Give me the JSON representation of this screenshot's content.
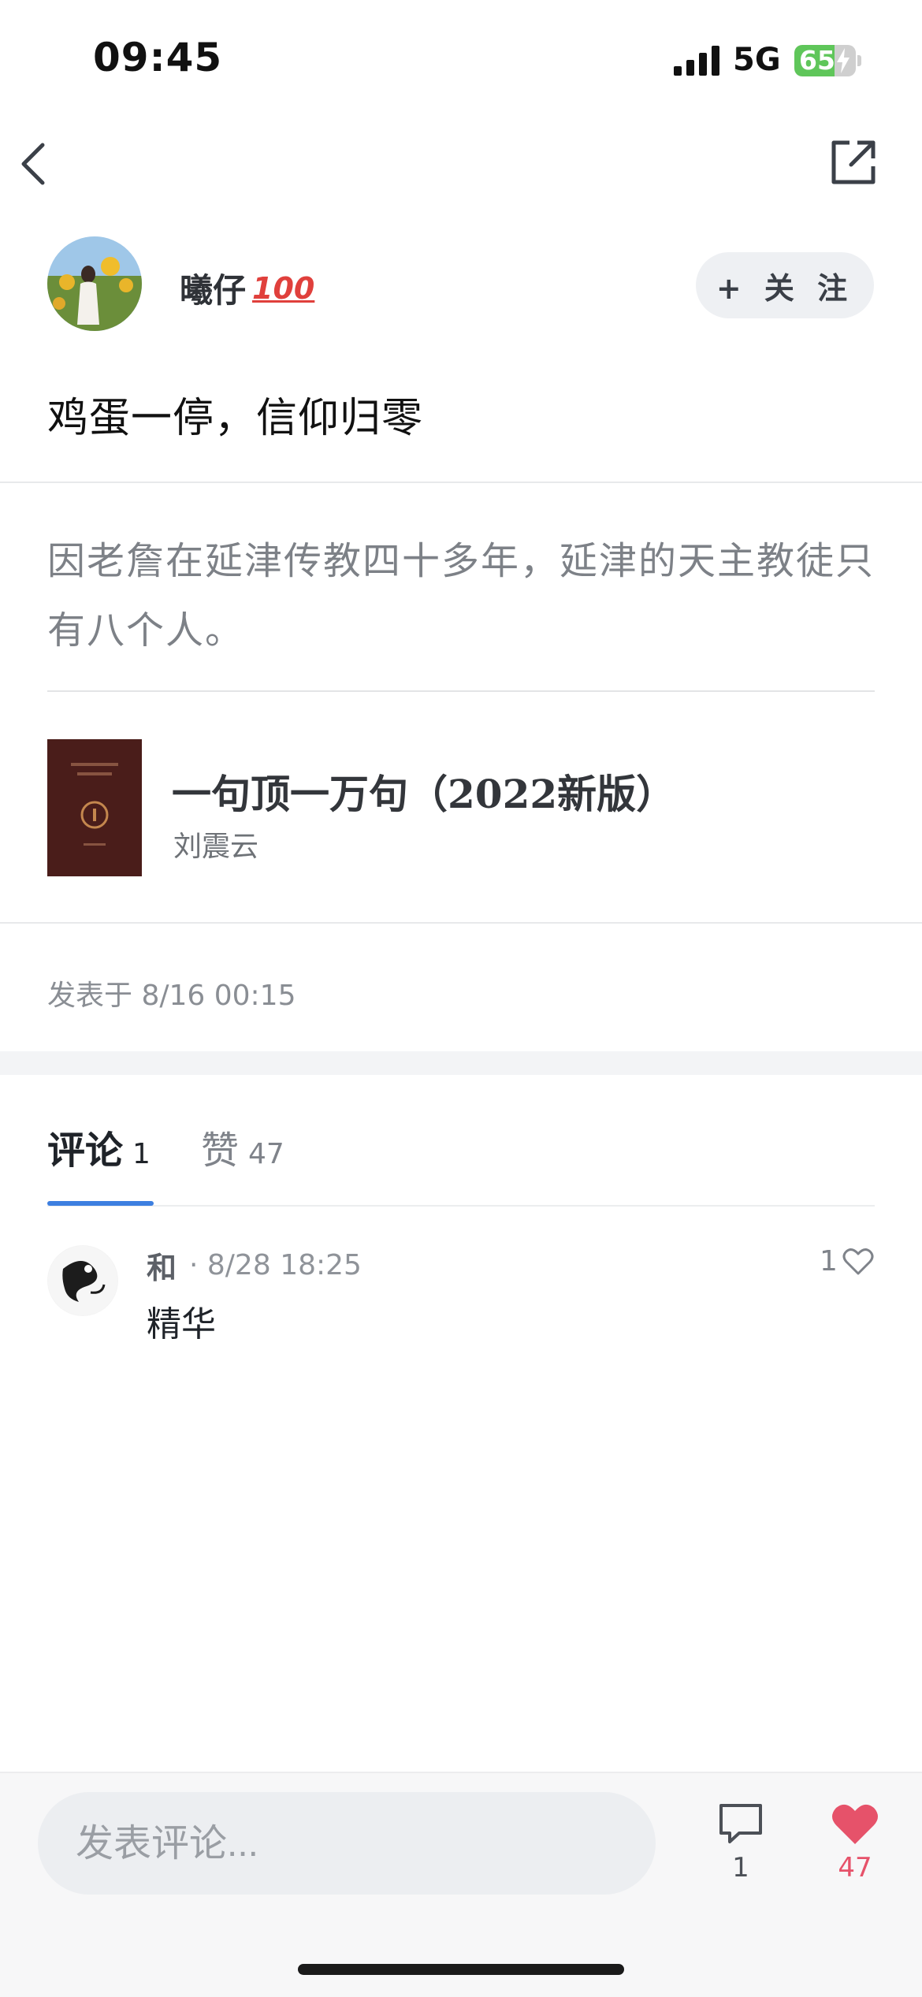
{
  "status_bar": {
    "time": "09:45",
    "network": "5G",
    "battery": "65",
    "battery_level": 0.65
  },
  "nav": {
    "back_icon": "chevron-left-icon",
    "share_icon": "share-icon"
  },
  "author": {
    "name": "曦仔",
    "badge": "100",
    "follow_label": "+ 关 注"
  },
  "post": {
    "title": "鸡蛋一停，信仰归零",
    "quote": "因老詹在延津传教四十多年，延津的天主教徒只有八个人。",
    "book": {
      "title": "一句顶一万句（2022新版）",
      "author": "刘震云"
    },
    "published": "发表于 8/16 00:15"
  },
  "tabs": [
    {
      "label": "评论",
      "count": "1"
    },
    {
      "label": "赞",
      "count": "47"
    }
  ],
  "comments": [
    {
      "user": "和",
      "time": "· 8/28 18:25",
      "text": "精华",
      "likes": "1"
    }
  ],
  "bottom_bar": {
    "input_placeholder": "发表评论...",
    "comment_count": "1",
    "like_count": "47"
  },
  "colors": {
    "accent": "#3d7fe0",
    "like": "#e6526a",
    "battery": "#5fc65a"
  }
}
